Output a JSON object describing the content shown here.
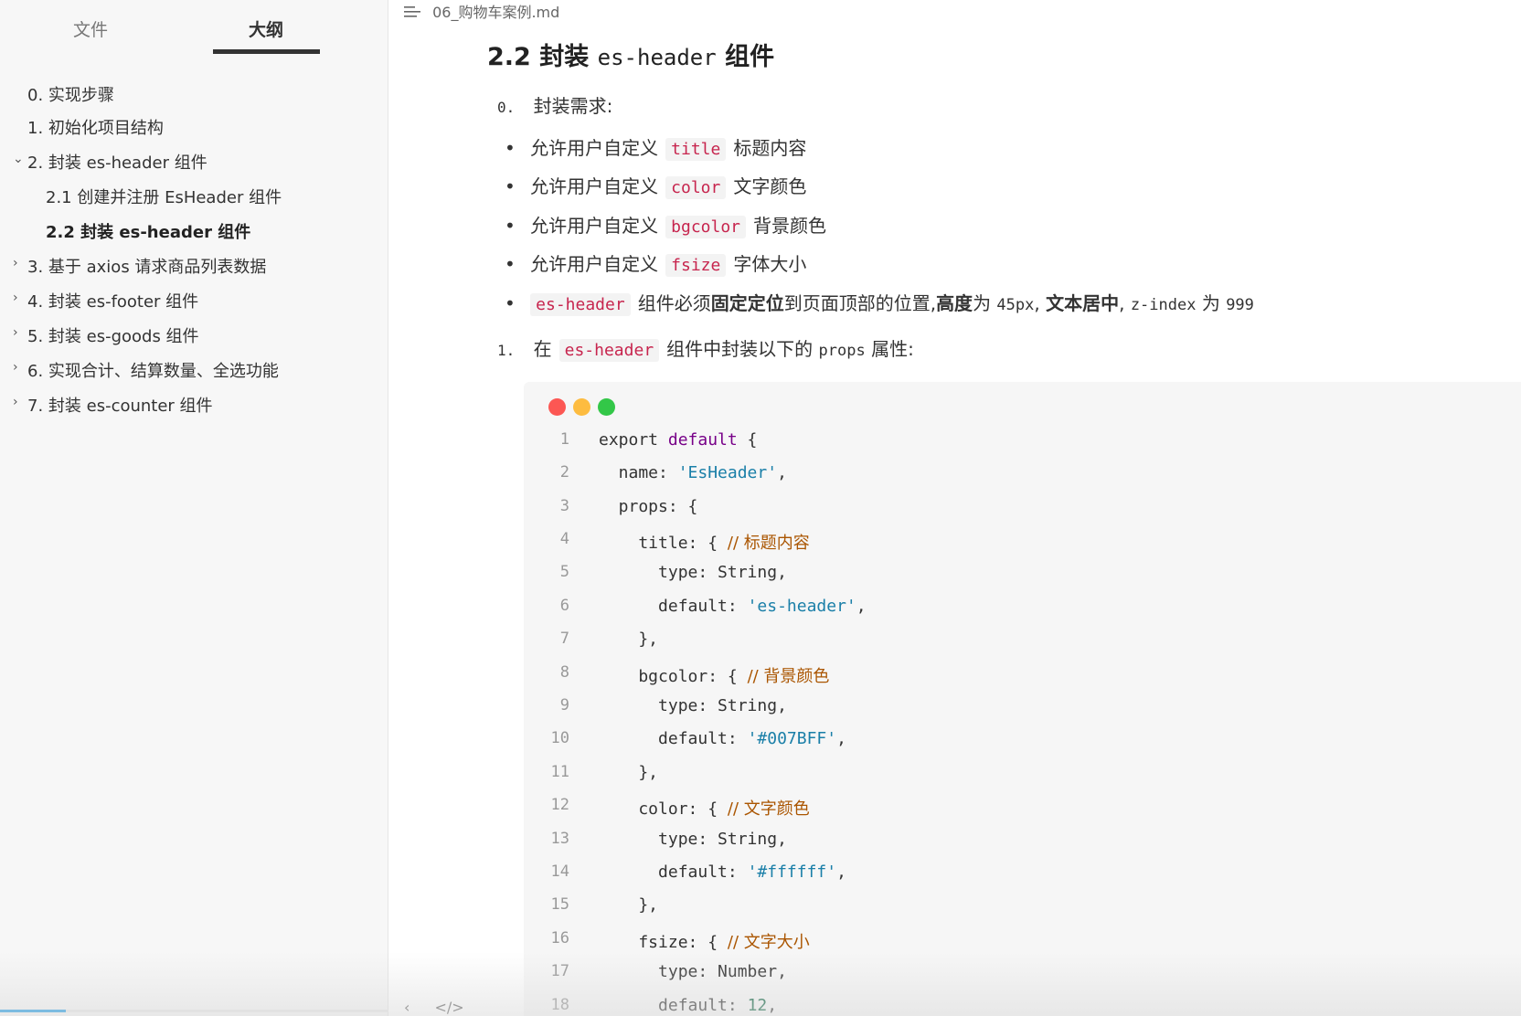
{
  "sidebar": {
    "tabs": [
      {
        "label": "文件"
      },
      {
        "label": "大纲"
      }
    ],
    "outline": [
      {
        "text": "0. 实现步骤"
      },
      {
        "text": "1. 初始化项目结构"
      },
      {
        "text": "2. 封装 es-header 组件"
      },
      {
        "text": "2.1 创建并注册 EsHeader 组件"
      },
      {
        "text": "2.2 封装 es-header 组件"
      },
      {
        "text": "3. 基于 axios 请求商品列表数据"
      },
      {
        "text": "4. 封装 es-footer 组件"
      },
      {
        "text": "5. 封装 es-goods 组件"
      },
      {
        "text": "6. 实现合计、结算数量、全选功能"
      },
      {
        "text": "7. 封装 es-counter 组件"
      }
    ],
    "progress": 0.17
  },
  "main": {
    "filename": "06_购物车案例.md",
    "heading": {
      "prefix": "2.2 封装",
      "code": "es-header",
      "suffix": "组件"
    },
    "step0": {
      "num": "0.",
      "text": "封装需求:"
    },
    "bullets": [
      {
        "pre": "允许用户自定义",
        "code": "title",
        "post": "标题内容"
      },
      {
        "pre": "允许用户自定义",
        "code": "color",
        "post": "文字颜色"
      },
      {
        "pre": "允许用户自定义",
        "code": "bgcolor",
        "post": "背景颜色"
      },
      {
        "pre": "允许用户自定义",
        "code": "fsize",
        "post": "字体大小"
      }
    ],
    "bullet5": {
      "code": "es-header",
      "t1": "组件必须",
      "b1": "固定定位",
      "t2": "到页面顶部的位置,",
      "b2": "高度",
      "t3": "为",
      "v1": "45px",
      "t4": ",",
      "b3": "文本居中",
      "t5": ",",
      "v2": "z-index",
      "t6": "为",
      "v3": "999"
    },
    "step1": {
      "num": "1.",
      "pre": "在",
      "code": "es-header",
      "mid": "组件中封装以下的",
      "mono": "props",
      "post": "属性:"
    },
    "code": [
      {
        "n": "1",
        "t": "export default {"
      },
      {
        "n": "2",
        "t": "  name: 'EsHeader',"
      },
      {
        "n": "3",
        "t": "  props: {"
      },
      {
        "n": "4",
        "t": "    title: { // 标题内容"
      },
      {
        "n": "5",
        "t": "      type: String,"
      },
      {
        "n": "6",
        "t": "      default: 'es-header',"
      },
      {
        "n": "7",
        "t": "    },"
      },
      {
        "n": "8",
        "t": "    bgcolor: { // 背景颜色"
      },
      {
        "n": "9",
        "t": "      type: String,"
      },
      {
        "n": "10",
        "t": "      default: '#007BFF',"
      },
      {
        "n": "11",
        "t": "    },"
      },
      {
        "n": "12",
        "t": "    color: { // 文字颜色"
      },
      {
        "n": "13",
        "t": "      type: String,"
      },
      {
        "n": "14",
        "t": "      default: '#ffffff',"
      },
      {
        "n": "15",
        "t": "    },"
      },
      {
        "n": "16",
        "t": "    fsize: { // 文字大小"
      },
      {
        "n": "17",
        "t": "      type: Number,"
      },
      {
        "n": "18",
        "t": "      default: 12,"
      }
    ]
  }
}
